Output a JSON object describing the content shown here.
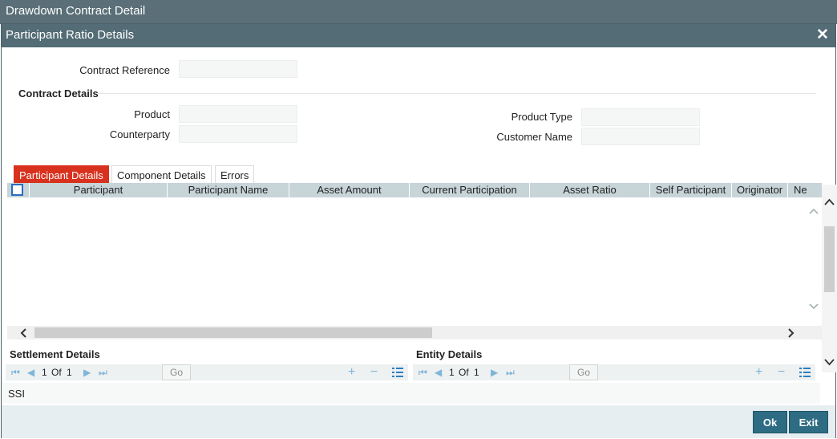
{
  "window": {
    "title": "Drawdown Contract Detail"
  },
  "modal": {
    "title": "Participant Ratio Details",
    "close_icon": "close-icon"
  },
  "fields": {
    "contract_reference": {
      "label": "Contract Reference",
      "value": ""
    },
    "product": {
      "label": "Product",
      "value": ""
    },
    "counterparty": {
      "label": "Counterparty",
      "value": ""
    },
    "product_type": {
      "label": "Product Type",
      "value": ""
    },
    "customer_name": {
      "label": "Customer Name",
      "value": ""
    }
  },
  "sections": {
    "contract_details": "Contract Details",
    "settlement_details": "Settlement Details",
    "entity_details": "Entity Details"
  },
  "tabs": [
    {
      "label": "Participant Details",
      "active": true
    },
    {
      "label": "Component Details",
      "active": false
    },
    {
      "label": "Errors",
      "active": false
    }
  ],
  "grid": {
    "columns": [
      "Participant",
      "Participant Name",
      "Asset Amount",
      "Current Participation",
      "Asset Ratio",
      "Self Participant",
      "Originator",
      "Ne"
    ],
    "rows": []
  },
  "pager": {
    "current": "1",
    "of_label": "Of",
    "total": "1",
    "go_label": "Go"
  },
  "ssi": {
    "label": "SSI"
  },
  "buttons": {
    "ok": "Ok",
    "exit": "Exit"
  },
  "colors": {
    "accent_tab": "#d8321e",
    "button": "#2d6c82",
    "title_bar": "#536c75"
  }
}
